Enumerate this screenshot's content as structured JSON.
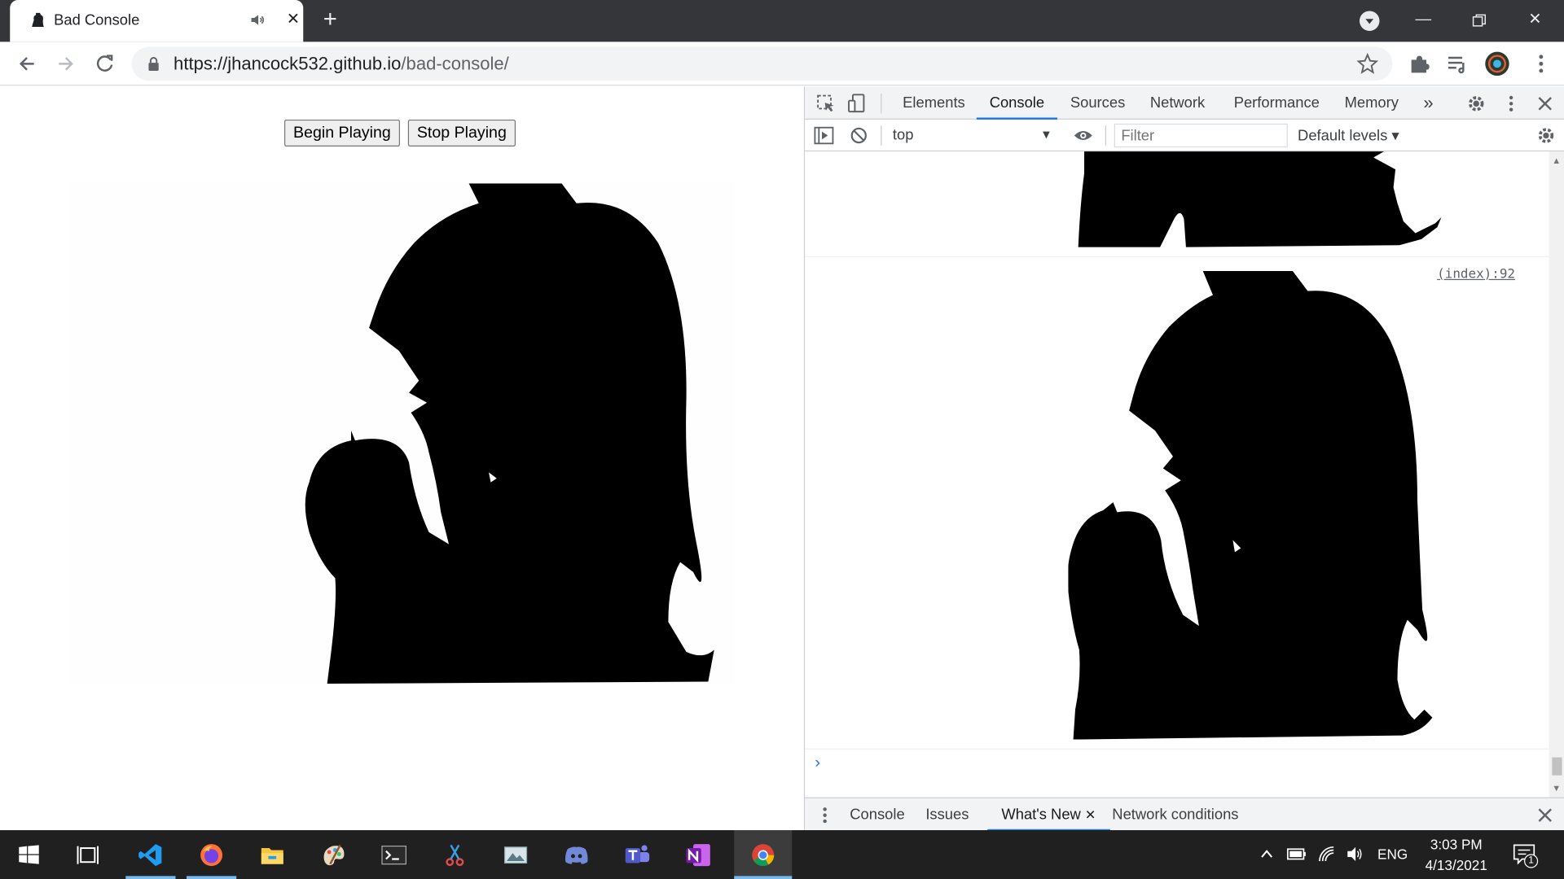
{
  "browser": {
    "tab_title": "Bad Console",
    "url_host": "https://jhancock532.github.io",
    "url_path": "/bad-console/"
  },
  "page": {
    "begin_button": "Begin Playing",
    "stop_button": "Stop Playing"
  },
  "devtools": {
    "tabs": [
      "Elements",
      "Console",
      "Sources",
      "Network",
      "Performance",
      "Memory"
    ],
    "active_tab": "Console",
    "context": "top",
    "filter_placeholder": "Filter",
    "levels": "Default levels",
    "source_link": "(index):92",
    "drawer_tabs": [
      "Console",
      "Issues",
      "What's New",
      "Network conditions"
    ],
    "drawer_active": "What's New"
  },
  "taskbar": {
    "apps": [
      "start-icon",
      "task-view-icon",
      "vscode-icon",
      "firefox-icon",
      "file-explorer-icon",
      "paint-icon",
      "terminal-icon",
      "snip-icon",
      "photos-icon",
      "discord-icon",
      "teams-icon",
      "onenote-icon",
      "chrome-icon"
    ],
    "language": "ENG",
    "time": "3:03 PM",
    "date": "4/13/2021",
    "notification_count": "1"
  },
  "colors": {
    "titlebar": "#35363a",
    "accent": "#1a73e8",
    "taskbar": "#202020"
  }
}
